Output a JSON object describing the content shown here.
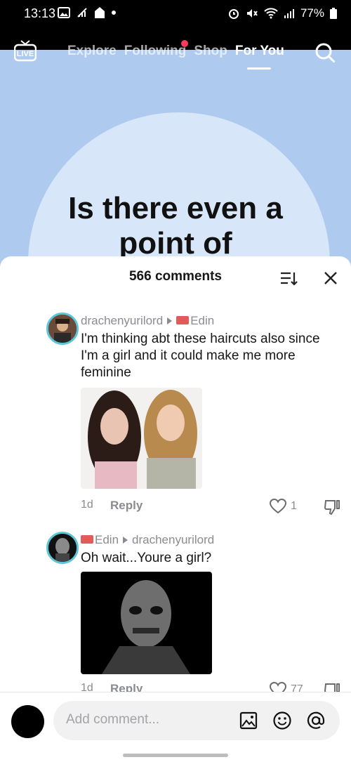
{
  "status": {
    "time": "13:13",
    "battery": "77%"
  },
  "nav": {
    "live_label": "LIVE",
    "tabs": [
      {
        "label": "Explore"
      },
      {
        "label": "Following"
      },
      {
        "label": "Shop"
      },
      {
        "label": "For You"
      }
    ],
    "active_tab": "For You"
  },
  "video": {
    "headline_line1": "Is there even a",
    "headline_line2": "point of"
  },
  "comments_panel": {
    "count_label": "566 comments",
    "comments": [
      {
        "user": "drachenyurilord",
        "reply_to": "Edin",
        "text": "I'm thinking abt these haircuts also since I'm a girl and it could make me more feminine",
        "age": "1d",
        "reply_label": "Reply",
        "likes": "1"
      },
      {
        "user": "Edin",
        "reply_to": "drachenyurilord",
        "text": "Oh wait...Youre a girl?",
        "age": "1d",
        "reply_label": "Reply",
        "likes": "77"
      }
    ]
  },
  "composer": {
    "placeholder": "Add comment..."
  },
  "colors": {
    "accent_red": "#ff3b5c",
    "avatar_ring": "#5cc6d6",
    "bg_blue": "#aecbef"
  }
}
